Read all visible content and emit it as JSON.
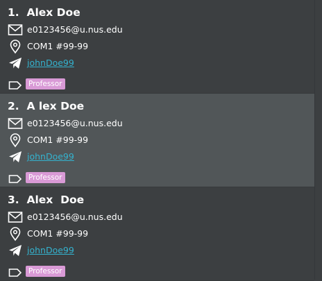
{
  "persons": [
    {
      "name": "1.  Alex Doe",
      "email": "e0123456@u.nus.edu",
      "address": "COM1 #99-99",
      "telegram": "johnDoe99",
      "tag": "Professor"
    },
    {
      "name": "2.  A lex Doe",
      "email": "e0123456@u.nus.edu",
      "address": "COM1 #99-99",
      "telegram": "johnDoe99",
      "tag": "Professor"
    },
    {
      "name": "3.  Alex  Doe",
      "email": "e0123456@u.nus.edu",
      "address": "COM1 #99-99",
      "telegram": "johnDoe99",
      "tag": "Professor"
    }
  ],
  "selected_index": 1,
  "icons": {
    "email": "mail-icon",
    "address": "location-pin-icon",
    "telegram": "telegram-icon",
    "tag": "tag-icon"
  },
  "colors": {
    "background": "#3c3f41",
    "selected_background": "#515658",
    "link": "#34b3cf",
    "tag_background": "#d99ad6"
  }
}
